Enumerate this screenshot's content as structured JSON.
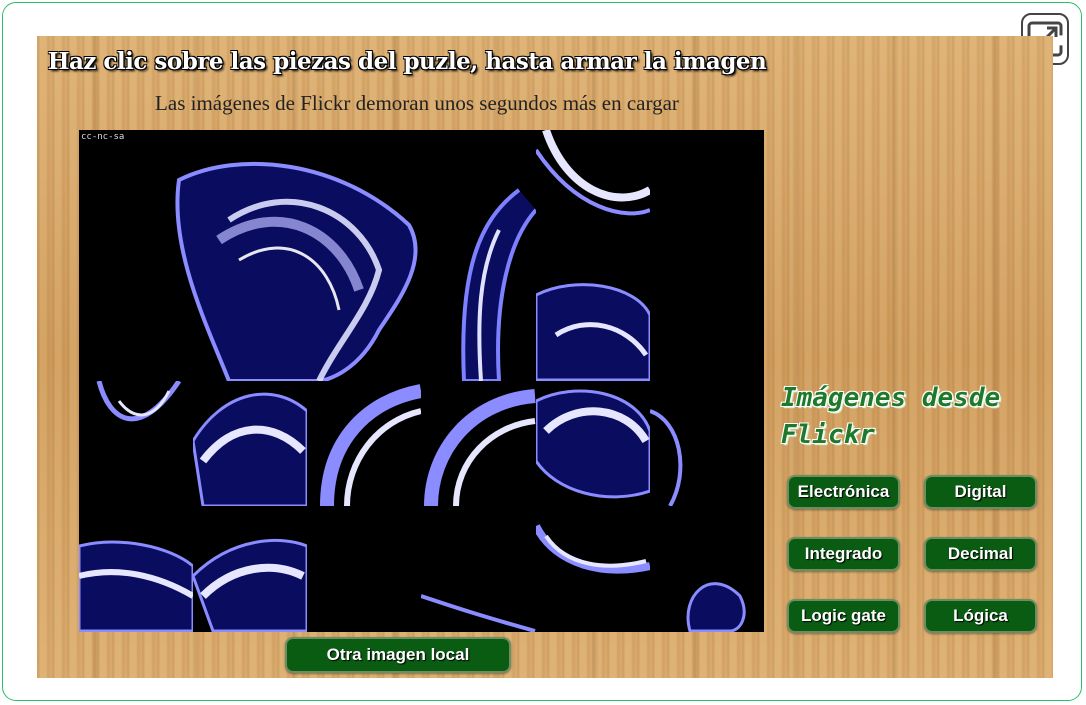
{
  "header": {
    "title": "Haz clic sobre las piezas del puzle, hasta armar la imagen",
    "subtitle": "Las imágenes de Flickr demoran unos segundos más en cargar"
  },
  "puzzle": {
    "license": "cc-nc-sa"
  },
  "sidebar": {
    "title": "Imágenes desde Flickr",
    "buttons": [
      "Electrónica",
      "Digital",
      "Integrado",
      "Decimal",
      "Logic gate",
      "Lógica"
    ]
  },
  "footer": {
    "local_button": "Otra imagen local"
  },
  "icons": {
    "expand": "expand-icon"
  },
  "colors": {
    "button_green": "#0a5c13",
    "title_green": "#1e7a2a",
    "frame_border": "#2bbf68",
    "wood": "#d6a362"
  }
}
